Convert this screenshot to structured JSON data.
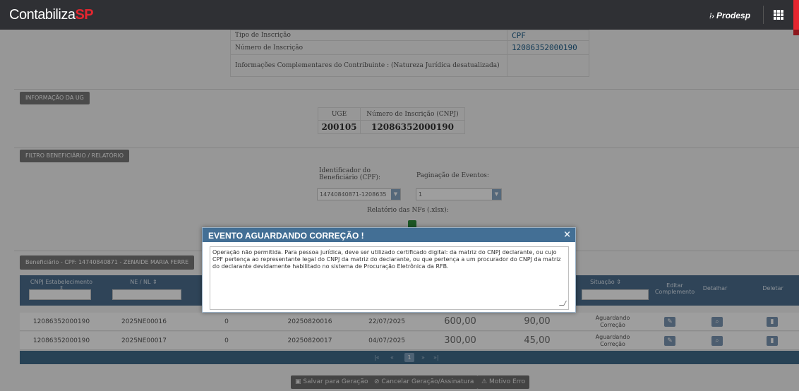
{
  "header": {
    "brand_main": "Contabiliza",
    "brand_accent": "SP",
    "partner_logo": "Prodesp",
    "menu_icon": "grid-icon"
  },
  "contribuinte": {
    "rows": [
      {
        "label": "Tipo de Inscrição",
        "value": "CPF"
      },
      {
        "label": "Número de Inscrição",
        "value": "12086352000190"
      },
      {
        "label": "Informações Complementares do Contribuinte : (Natureza Jurídica desatualizada)",
        "value": ""
      }
    ]
  },
  "ug_section": {
    "tag": "INFORMAÇÃO DA UG",
    "col_ug": "UGE",
    "col_cnpj": "Número de Inscrição (CNPJ)",
    "ug_value": "200105",
    "cnpj_value": "12086352000190"
  },
  "filter_section": {
    "tag": "FILTRO BENEFICIÁRIO / RELATÓRIO",
    "beneficiario_label": "Identificador do Beneficiário (CPF):",
    "beneficiario_value": "14740840871-1208635",
    "paginacao_label": "Paginação de Eventos:",
    "paginacao_value": "1",
    "relatorio_label": "Relatório das NFs (.xlsx):"
  },
  "list_section": {
    "tag": "Beneficiário - CPF: 14740840871 - ZENAIDE MARIA FERRE",
    "columns": {
      "cnpj": "CNPJ Estabelecimento",
      "ne": "NE / NL",
      "situacao": "Situação",
      "editar": "Editar Complemento",
      "detalhar": "Detalhar",
      "deletar": "Deletar"
    },
    "rows": [
      {
        "cnpj": "12086352000190",
        "ne": "2025NE00016",
        "c3": "0",
        "c4": "20250820016",
        "data": "22/07/2025",
        "valor": "600,00",
        "imposto": "90,00",
        "situacao_a": "Aguardando",
        "situacao_b": "Correção"
      },
      {
        "cnpj": "12086352000190",
        "ne": "2025NE00017",
        "c3": "0",
        "c4": "20250820017",
        "data": "04/07/2025",
        "valor": "300,00",
        "imposto": "45,00",
        "situacao_a": "Aguardando",
        "situacao_b": "Correção"
      }
    ],
    "pager": {
      "first": "|«",
      "prev": "«",
      "current": "1",
      "next": "»",
      "last": "»|"
    }
  },
  "actions": {
    "salvar": "Salvar para Geração",
    "cancelar": "Cancelar Geração/Assinatura",
    "motivo": "Motivo Erro"
  },
  "modal": {
    "title": "EVENTO AGUARDANDO CORREÇÃO !",
    "close": "×",
    "message": "Operação não permitida. Para pessoa jurídica, deve ser utilizado certificado digital: da matriz do CNPJ declarante, ou cujo CPF pertença ao representante legal do CNPJ da matriz do declarante, ou que pertença a um procurador do CNPJ da matriz do declarante devidamente habilitado no sistema de Procuração Eletrônica da RFB."
  },
  "colors": {
    "brand_red": "#e4262f",
    "header_bg": "#2f3034",
    "modal_header": "#436f95"
  }
}
